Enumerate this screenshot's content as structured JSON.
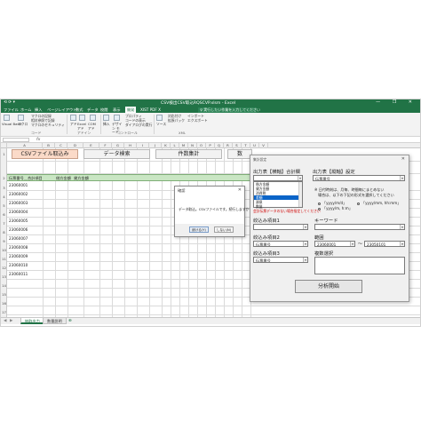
{
  "titlebar": {
    "title": "CSV検出CSV取込RQSCVP.xlsm - Excel",
    "quick_access": "⟲ ⟳ ▾",
    "controls": "— ❐ ✕"
  },
  "menu": {
    "tabs": [
      "ファイル",
      "ホーム",
      "挿入",
      "ページレイアウト",
      "数式",
      "データ",
      "校閲",
      "表示",
      "開発",
      "XIST PDF X"
    ],
    "active_index": 8,
    "tellme": "♀ 実行したい作業を入力してください"
  },
  "ribbon": {
    "items": [
      "Visual Basic",
      "マクロ",
      "マクロの記録",
      "相対参照で記録",
      "マクロのセキュリティ",
      "アド",
      "Excel アド",
      "COM アド",
      "挿入",
      "デザイン モード",
      "プロパティ",
      "コードの表示",
      "ダイアログの実行",
      "ソース",
      "対応付け",
      "拡張パック",
      "インポート",
      "エクスポート"
    ],
    "groups": [
      "コード",
      "アドイン",
      "コントロール",
      "XML"
    ]
  },
  "formula": {
    "namebox": "",
    "fx": "fx"
  },
  "columns": [
    "A",
    "B",
    "C",
    "D",
    "E",
    "F",
    "G",
    "H",
    "I",
    "J",
    "K",
    "L",
    "M",
    "N",
    "O",
    "P",
    "Q",
    "R",
    "S",
    "T",
    "U",
    "V"
  ],
  "rows": [
    "1",
    "2",
    "3",
    "4",
    "5",
    "6",
    "7",
    "8",
    "9",
    "10",
    "11",
    "12",
    "13",
    "14",
    "15",
    "16",
    "17",
    "18",
    "19"
  ],
  "sheet": {
    "buttons": [
      "CSVファイル取込み",
      "データ検索",
      "件数集計",
      "数"
    ],
    "headers": [
      "伝票番号＿合計項目",
      "借方金額",
      "貸方金額"
    ],
    "values": [
      "23060001",
      "23060002",
      "23060003",
      "23060004",
      "23060005",
      "23060006",
      "23060007",
      "23060008",
      "23060009",
      "23060010",
      "23060011"
    ]
  },
  "sheettabs": {
    "tabs": [
      "抽取出力",
      "数量説明"
    ],
    "active": 0,
    "add": "⊕"
  },
  "msgbox": {
    "title": "確認",
    "body": "データ取込。CSVファイルです。続行しますか？",
    "ok": "続ける(Y)",
    "cancel": "しない(N)",
    "close": "✕"
  },
  "form": {
    "title": "集計設定",
    "close": "✕",
    "label_agg_field": "出力表【横軸】合計欄",
    "agg_field_value": "",
    "agg_list": [
      "借方金額",
      "貸方金額",
      "消費税",
      "差額",
      "源泉",
      "数量"
    ],
    "agg_selected": 3,
    "label_setting": "出力表【縦軸】設定",
    "setting_value": "伝票番号",
    "note1": "※ 日付時刻は、月毎、時間毎にまとめない",
    "note2": "場合は、以下の下記の形式を選択してください",
    "radio1": "「yyyy/m/d」",
    "radio2": "「yyyy/mm, hh:mm」",
    "radio3": "「yyyy/m, h:m」",
    "warning": "会計伝票データのない場合指定してください",
    "label_filter1": "絞込み項目1",
    "filter1_value": "",
    "label_keyword": "キーワード",
    "keyword_value": "",
    "label_filter2": "絞込み項目2",
    "filter2_value": "伝票番号",
    "label_range": "範囲",
    "range_from": "23060001",
    "range_to": "23050101",
    "tilde": "〜",
    "label_filter3": "絞込み項目3",
    "filter3_value": "伝票番号",
    "label_multi": "複数選択",
    "run": "分析開始",
    "arrow": "▾"
  }
}
